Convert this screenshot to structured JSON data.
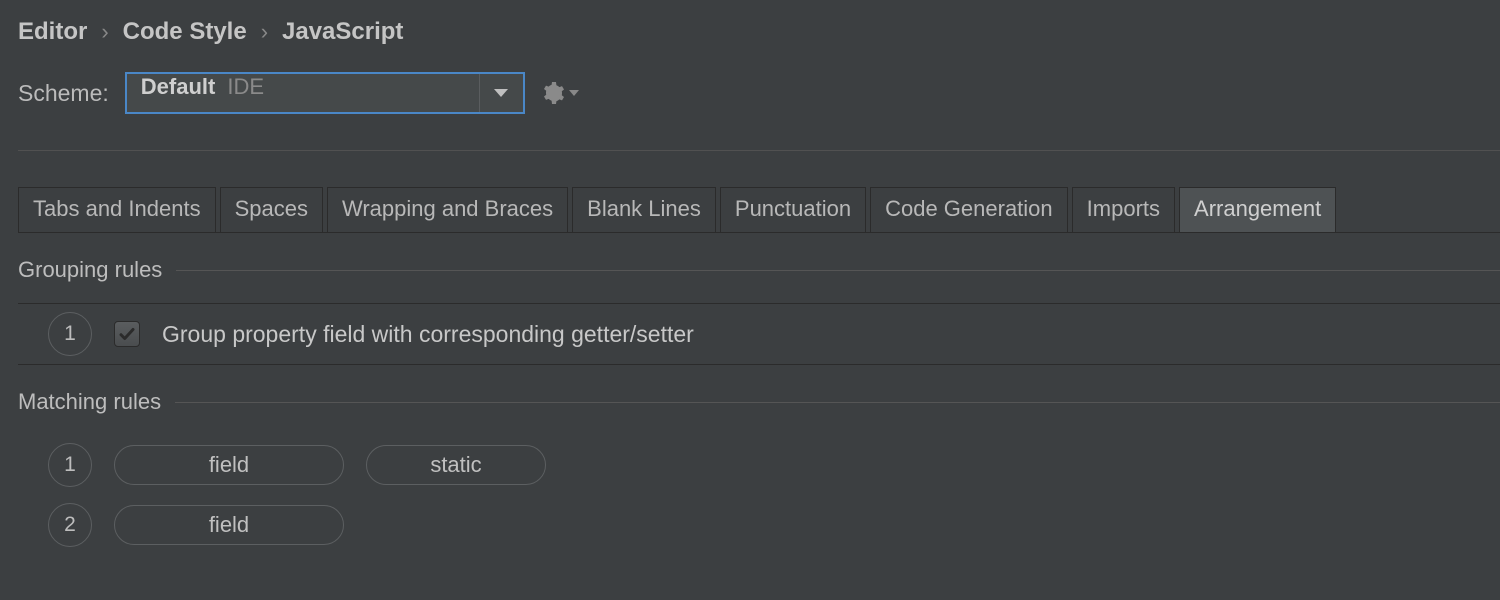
{
  "breadcrumb": [
    "Editor",
    "Code Style",
    "JavaScript"
  ],
  "scheme": {
    "label": "Scheme:",
    "value": "Default",
    "scope": "IDE"
  },
  "tabs": [
    {
      "label": "Tabs and Indents",
      "active": false
    },
    {
      "label": "Spaces",
      "active": false
    },
    {
      "label": "Wrapping and Braces",
      "active": false
    },
    {
      "label": "Blank Lines",
      "active": false
    },
    {
      "label": "Punctuation",
      "active": false
    },
    {
      "label": "Code Generation",
      "active": false
    },
    {
      "label": "Imports",
      "active": false
    },
    {
      "label": "Arrangement",
      "active": true
    }
  ],
  "sections": {
    "grouping_title": "Grouping rules",
    "matching_title": "Matching rules"
  },
  "grouping_rules": [
    {
      "num": "1",
      "checked": true,
      "label": "Group property field with corresponding getter/setter"
    }
  ],
  "matching_rules": [
    {
      "num": "1",
      "tokens": [
        "field",
        "static"
      ]
    },
    {
      "num": "2",
      "tokens": [
        "field"
      ]
    }
  ]
}
